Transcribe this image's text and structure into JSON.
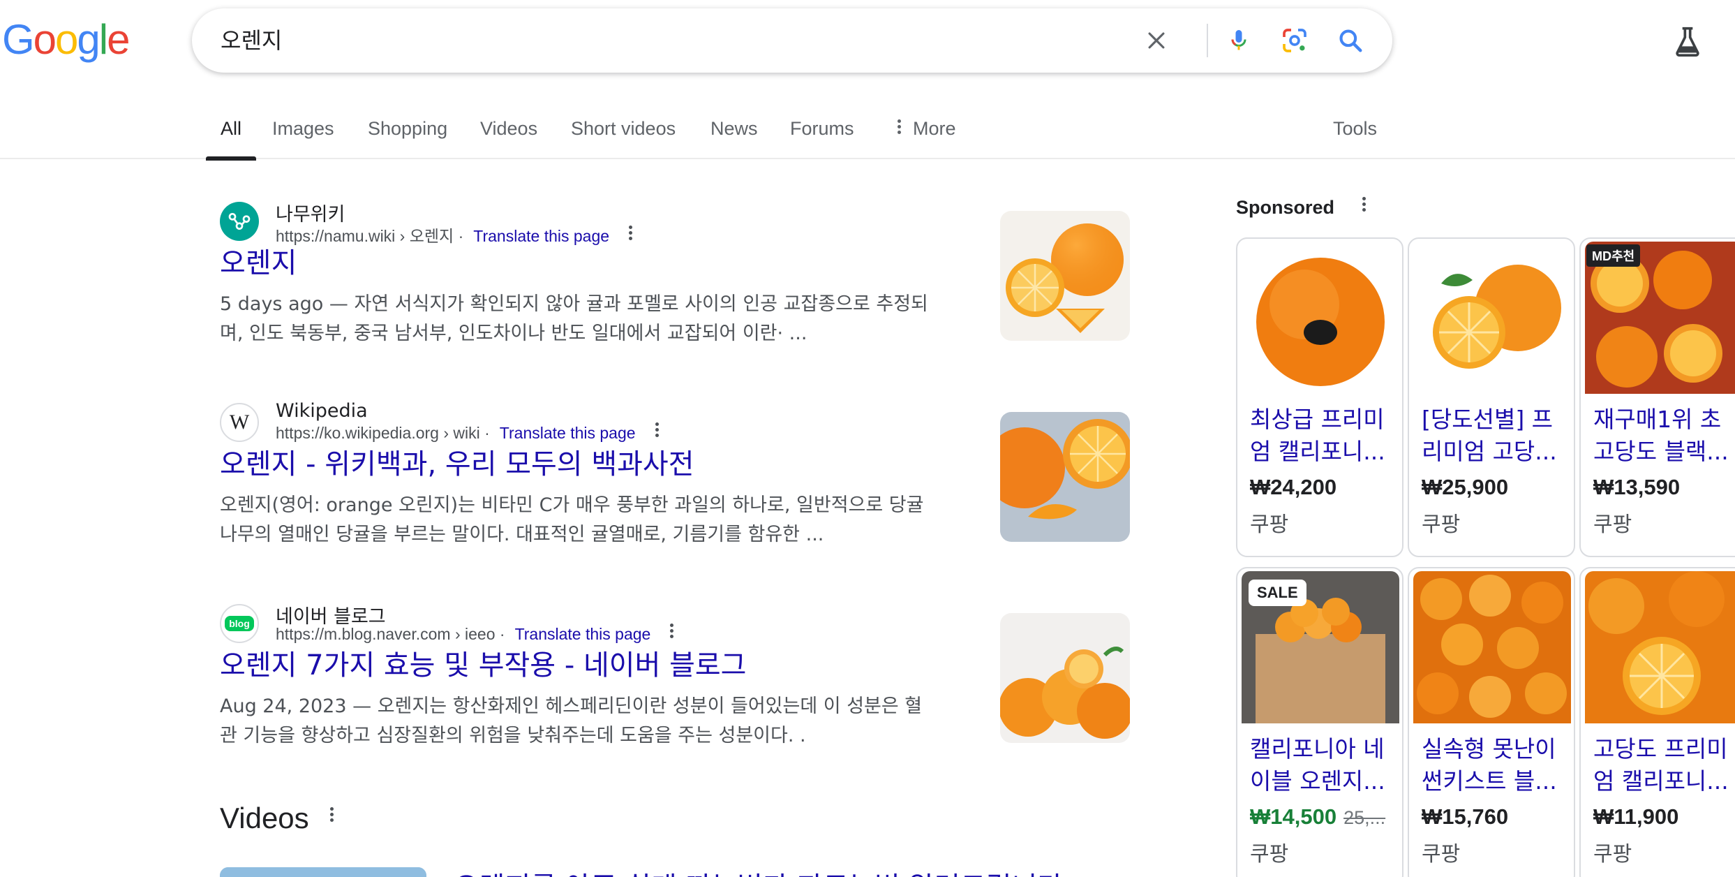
{
  "logo": {
    "text": "Google"
  },
  "search": {
    "query": "오렌지"
  },
  "tabs": [
    {
      "label": "All"
    },
    {
      "label": "Images"
    },
    {
      "label": "Shopping"
    },
    {
      "label": "Videos"
    },
    {
      "label": "Short videos"
    },
    {
      "label": "News"
    },
    {
      "label": "Forums"
    },
    {
      "label": "More"
    },
    {
      "label": "Tools"
    }
  ],
  "results": [
    {
      "site": "나무위키",
      "url": "https://namu.wiki › 오렌지",
      "translate": "Translate this page",
      "title": "오렌지",
      "snippet_line1": "5 days ago — 자연 서식지가 확인되지 않아 귤과 포멜로 사이의 인공 교잡종으로 추정되",
      "snippet_line2": "며, 인도 북동부, 중국 남서부, 인도차이나 반도 일대에서 교잡되어 이란· ..."
    },
    {
      "site": "Wikipedia",
      "url": "https://ko.wikipedia.org › wiki",
      "translate": "Translate this page",
      "title": "오렌지 - 위키백과, 우리 모두의 백과사전",
      "snippet_line1": "오렌지(영어: orange 오린지)는 비타민 C가 매우 풍부한 과일의 하나로, 일반적으로 당귤",
      "snippet_line2": "나무의 열매인 당귤을 부르는 말이다. 대표적인 귤열매로, 기름기를 함유한 ..."
    },
    {
      "site": "네이버 블로그",
      "url": "https://m.blog.naver.com › ieeo",
      "translate": "Translate this page",
      "title": "오렌지 7가지 효능 및 부작용 - 네이버 블로그",
      "snippet_line1": "Aug 24, 2023 — 오렌지는 항산화제인 헤스페리딘이란 성분이 들어있는데 이 성분은 혈",
      "snippet_line2": "관 기능을 향상하고 심장질환의 위험을 낮춰주는데 도움을 주는 성분이다. ."
    }
  ],
  "videos": {
    "heading": "Videos",
    "first_title": "오렌지를 아주 쉽게 까는법과 자르는법 알려드립니다"
  },
  "sponsored": {
    "heading": "Sponsored",
    "products": [
      {
        "title": "최상급 프리미엄 캘리포니...",
        "price": "₩24,200",
        "store": "쿠팡"
      },
      {
        "title": "[당도선별] 프리미엄 고당...",
        "price": "₩25,900",
        "store": "쿠팡"
      },
      {
        "title": "재구매1위 초고당도 블랙...",
        "price": "₩13,590",
        "store": "쿠팡",
        "badge": "MD추천"
      },
      {
        "title": "캘리포니아 네이블 오렌지...",
        "price": "₩14,500",
        "old_price": "25,...",
        "store": "쿠팡",
        "badge": "SALE"
      },
      {
        "title": "실속형 못난이 썬키스트 블...",
        "price": "₩15,760",
        "store": "쿠팡"
      },
      {
        "title": "고당도 프리미엄 캘리포니...",
        "price": "₩11,900",
        "store": "쿠팡"
      }
    ]
  },
  "colors": {
    "link": "#1a0dab",
    "sale_price": "#188038",
    "accent_blue": "#4285f4"
  }
}
